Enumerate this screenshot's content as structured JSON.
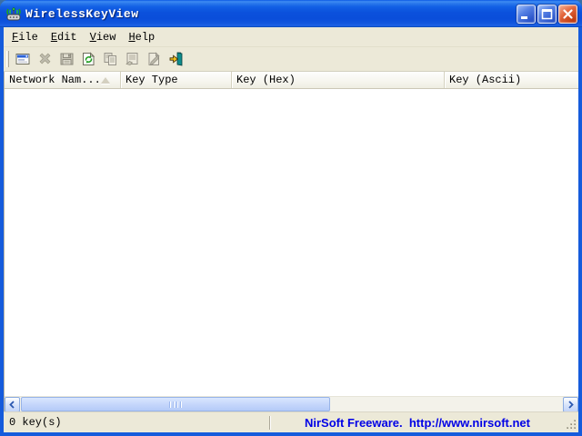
{
  "window": {
    "title": "WirelessKeyView",
    "app_icon": "wireless-antenna-icon",
    "controls": [
      {
        "name": "minimize-button",
        "icon": "minimize-icon"
      },
      {
        "name": "maximize-button",
        "icon": "maximize-icon"
      },
      {
        "name": "close-button",
        "icon": "close-icon"
      }
    ]
  },
  "menu": {
    "items": [
      {
        "label": "File"
      },
      {
        "label": "Edit"
      },
      {
        "label": "View"
      },
      {
        "label": "Help"
      }
    ]
  },
  "toolbar": {
    "buttons": [
      {
        "icon": "report-options-icon",
        "enabled": true
      },
      {
        "icon": "delete-icon",
        "enabled": false
      },
      {
        "icon": "save-icon",
        "enabled": false
      },
      {
        "icon": "refresh-icon",
        "enabled": true
      },
      {
        "icon": "copy-icon",
        "enabled": false
      },
      {
        "icon": "properties-icon",
        "enabled": false
      },
      {
        "icon": "html-report-icon",
        "enabled": false
      },
      {
        "icon": "exit-icon",
        "enabled": true
      }
    ]
  },
  "table": {
    "columns": [
      {
        "label": "Network Nam...",
        "sorted": "ascending"
      },
      {
        "label": "Key Type",
        "sorted": ""
      },
      {
        "label": "Key (Hex)",
        "sorted": ""
      },
      {
        "label": "Key (Ascii)",
        "sorted": ""
      }
    ],
    "rows": []
  },
  "scrollbar": {
    "orientation": "horizontal",
    "left_arrow_icon": "chevron-left-icon",
    "right_arrow_icon": "chevron-right-icon"
  },
  "status_bar": {
    "left": "0 key(s)",
    "right": "NirSoft Freeware.  http://www.nirsoft.net"
  },
  "colors": {
    "titlebar_blue": "#0B51DC",
    "chrome_bg": "#ECE9D8",
    "close_red": "#C33E12",
    "link_blue": "#0000E6",
    "list_bg": "#FFFFFF"
  }
}
